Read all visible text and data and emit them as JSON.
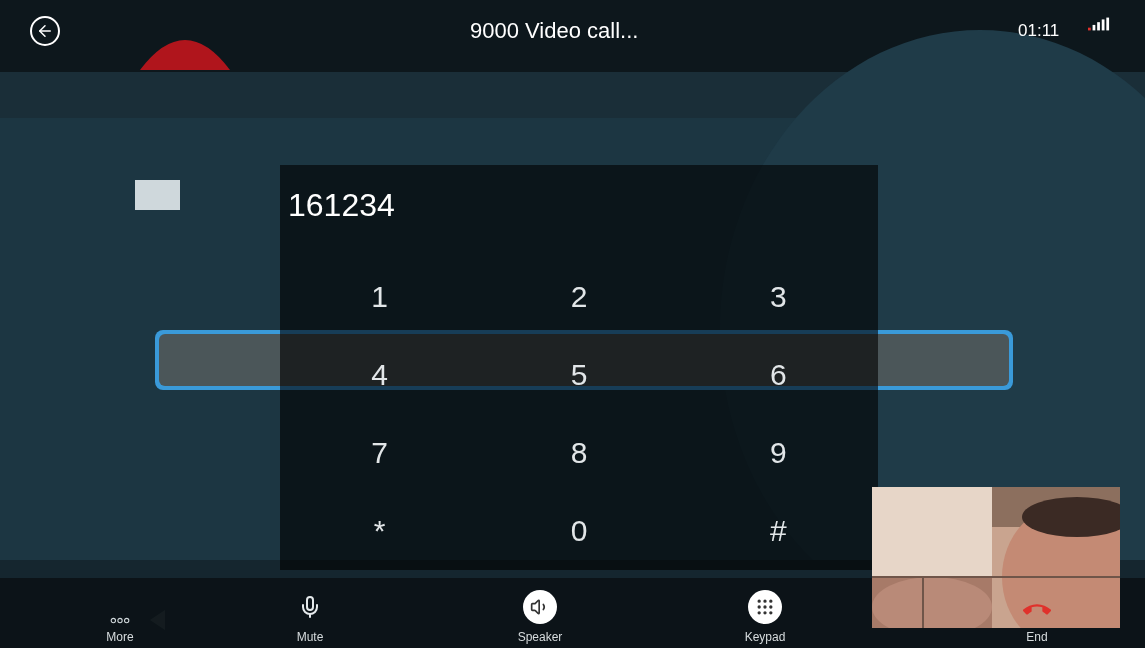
{
  "status_bar": {
    "title": "9000 Video call...",
    "time": "01:11"
  },
  "keypad": {
    "entered": "161234",
    "keys": [
      "1",
      "2",
      "3",
      "4",
      "5",
      "6",
      "7",
      "8",
      "9",
      "*",
      "0",
      "#"
    ]
  },
  "toolbar": [
    {
      "label": "More",
      "kind": "more"
    },
    {
      "label": "Mute",
      "kind": "mute",
      "on": false
    },
    {
      "label": "Speaker",
      "kind": "speaker",
      "on": true
    },
    {
      "label": "Keypad",
      "kind": "keypad",
      "on": true
    },
    {
      "label": "End",
      "kind": "end"
    }
  ]
}
